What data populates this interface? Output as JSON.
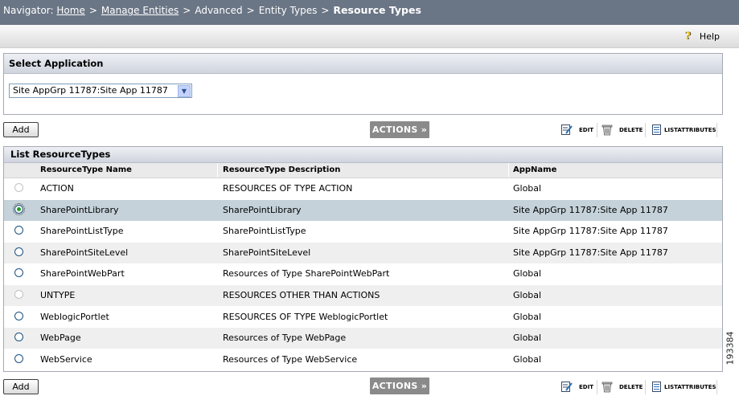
{
  "navigator": {
    "label": "Navigator:",
    "crumbs": [
      {
        "text": "Home",
        "link": true
      },
      {
        "text": "Manage Entities",
        "link": true
      },
      {
        "text": "Advanced",
        "link": false
      },
      {
        "text": "Entity Types",
        "link": false
      }
    ],
    "separator": ">",
    "current": "Resource Types"
  },
  "help": {
    "icon": "question-icon",
    "label": "Help"
  },
  "select_application": {
    "title": "Select Application",
    "selected": "Site AppGrp 11787:Site App 11787"
  },
  "toolbar": {
    "add_label": "Add",
    "actions_label": "ACTIONS",
    "actions_arrow": "»",
    "edit_label": "EDIT",
    "delete_label": "DELETE",
    "list_attributes_label": "LISTATTRIBUTES"
  },
  "list": {
    "title": "List ResourceTypes",
    "columns": [
      "ResourceType Name",
      "ResourceType Description",
      "AppName"
    ],
    "rows": [
      {
        "name": "ACTION",
        "description": "RESOURCES OF TYPE ACTION",
        "app": "Global",
        "selected": false,
        "disabled": true
      },
      {
        "name": "SharePointLibrary",
        "description": "SharePointLibrary",
        "app": "Site AppGrp 11787:Site App 11787",
        "selected": true,
        "disabled": false
      },
      {
        "name": "SharePointListType",
        "description": "SharePointListType",
        "app": "Site AppGrp 11787:Site App 11787",
        "selected": false,
        "disabled": false
      },
      {
        "name": "SharePointSiteLevel",
        "description": "SharePointSiteLevel",
        "app": "Site AppGrp 11787:Site App 11787",
        "selected": false,
        "disabled": false
      },
      {
        "name": "SharePointWebPart",
        "description": "Resources of Type SharePointWebPart",
        "app": "Global",
        "selected": false,
        "disabled": false
      },
      {
        "name": "UNTYPE",
        "description": "RESOURCES OTHER THAN ACTIONS",
        "app": "Global",
        "selected": false,
        "disabled": true
      },
      {
        "name": "WeblogicPortlet",
        "description": "RESOURCES OF TYPE WeblogicPortlet",
        "app": "Global",
        "selected": false,
        "disabled": false
      },
      {
        "name": "WebPage",
        "description": "Resources of Type WebPage",
        "app": "Global",
        "selected": false,
        "disabled": false
      },
      {
        "name": "WebService",
        "description": "Resources of Type WebService",
        "app": "Global",
        "selected": false,
        "disabled": false
      }
    ]
  },
  "figure_id": "193384",
  "colors": {
    "nav_bg": "#6a7585",
    "row_alt": "#efefef",
    "row_selected": "#c5d2da",
    "actions_bg": "#8a8a8a"
  }
}
